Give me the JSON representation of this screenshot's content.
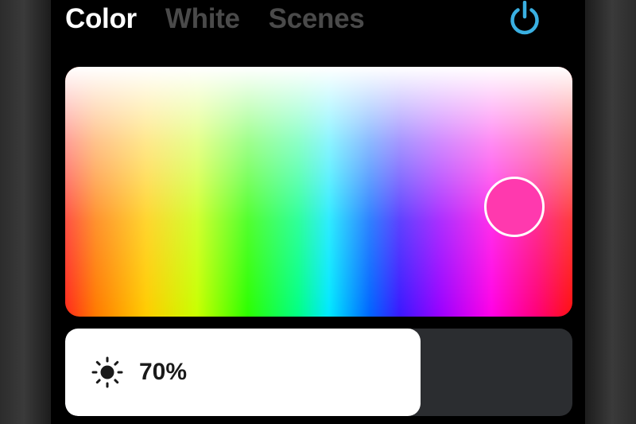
{
  "tabs": [
    {
      "label": "Color",
      "active": true
    },
    {
      "label": "White",
      "active": false
    },
    {
      "label": "Scenes",
      "active": false
    }
  ],
  "power": {
    "icon": "power-icon",
    "color": "#3ab0e2"
  },
  "color_picker": {
    "selected_color": "#ff39ae"
  },
  "brightness": {
    "icon": "sun-icon",
    "value_label": "70%",
    "level": 0.7
  }
}
